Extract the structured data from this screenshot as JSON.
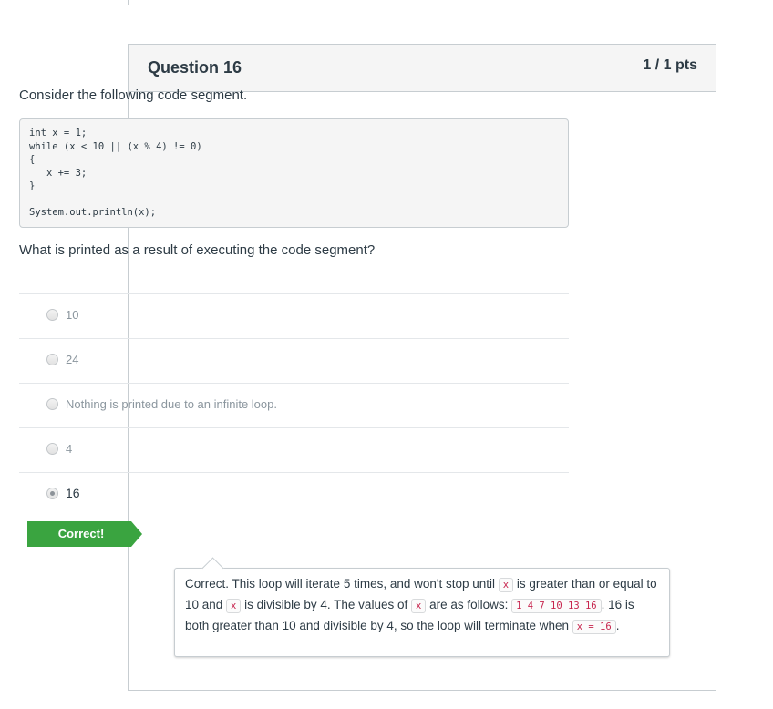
{
  "question": {
    "title": "Question 16",
    "points": "1 / 1 pts",
    "prompt": "Consider the following code segment.",
    "code": "int x = 1;\nwhile (x < 10 || (x % 4) != 0)\n{\n   x += 3;\n}\n\nSystem.out.println(x);",
    "question_text": "What is printed as a result of executing the code segment?"
  },
  "answers": [
    {
      "label": "10",
      "selected": false
    },
    {
      "label": "24",
      "selected": false
    },
    {
      "label": "Nothing is printed due to an infinite loop.",
      "selected": false
    },
    {
      "label": "4",
      "selected": false
    },
    {
      "label": "16",
      "selected": true
    }
  ],
  "result_flag": {
    "label": "Correct!",
    "color": "#3aa440"
  },
  "feedback": {
    "t1": "Correct. This loop will iterate 5 times, and won't stop until ",
    "c1": "x",
    "t2": " is greater than or equal to 10 and ",
    "c2": "x",
    "t3": " is divisible by 4. The values of ",
    "c3": "x",
    "t4": " are as follows: ",
    "c4": "1 4 7 10 13 16",
    "t5": ". 16 is both greater than 10 and divisible by 4, so the loop will terminate when ",
    "c5": "x = 16",
    "t6": "."
  }
}
